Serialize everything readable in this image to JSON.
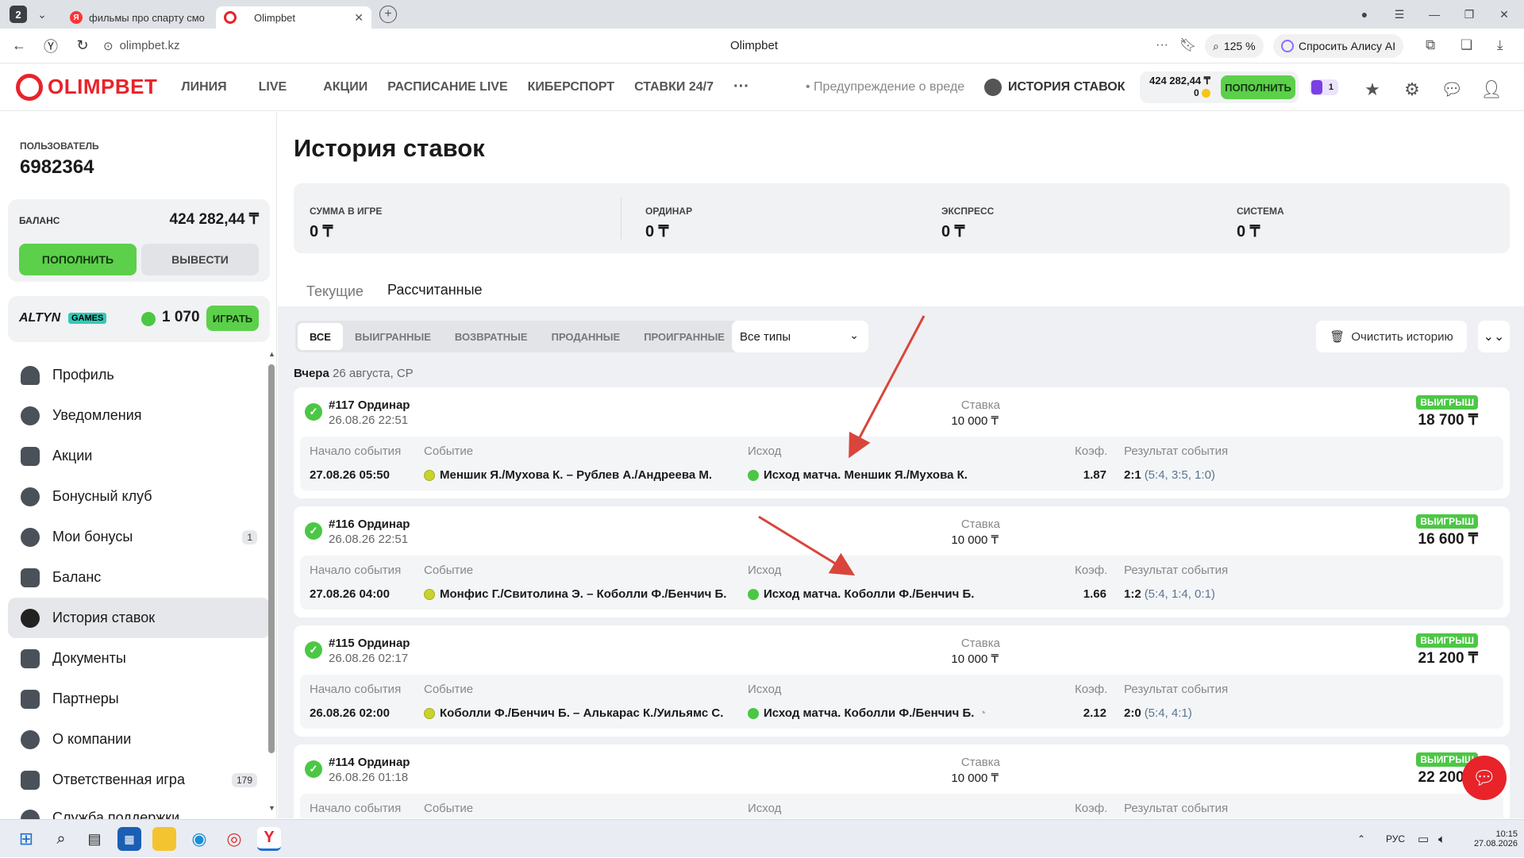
{
  "browser": {
    "tab_count": "2",
    "tabs": [
      {
        "title": "фильмы про спарту смот"
      },
      {
        "title": "Olimpbet"
      }
    ],
    "url": "olimpbet.kz",
    "page_title": "Olimpbet",
    "zoom": "125 %",
    "alice": "Спросить Алису AI"
  },
  "header": {
    "logo": "OLIMPBET",
    "nav": [
      "ЛИНИЯ",
      "LIVE",
      "АКЦИИ",
      "РАСПИСАНИЕ LIVE",
      "КИБЕРСПОРТ",
      "СТАВКИ 24/7"
    ],
    "more": "···",
    "warning": "Предупреждение о вреде",
    "history": "ИСТОРИЯ СТАВОК",
    "balance": "424 282,44 ₸",
    "bonus": "0",
    "topup": "ПОПОЛНИТЬ",
    "promo_count": "1"
  },
  "sidebar": {
    "user_label": "ПОЛЬЗОВАТЕЛЬ",
    "user_id": "6982364",
    "balance_label": "БАЛАНС",
    "balance_value": "424 282,44 ₸",
    "topup": "ПОПОЛНИТЬ",
    "withdraw": "ВЫВЕСТИ",
    "altyn": "ALTYN",
    "games": "GAMES",
    "altyn_value": "1 070",
    "play": "ИГРАТЬ",
    "menu": [
      {
        "label": "Профиль",
        "badge": ""
      },
      {
        "label": "Уведомления",
        "badge": ""
      },
      {
        "label": "Акции",
        "badge": ""
      },
      {
        "label": "Бонусный клуб",
        "badge": ""
      },
      {
        "label": "Мои бонусы",
        "badge": "1"
      },
      {
        "label": "Баланс",
        "badge": ""
      },
      {
        "label": "История ставок",
        "badge": ""
      },
      {
        "label": "Документы",
        "badge": ""
      },
      {
        "label": "Партнеры",
        "badge": ""
      },
      {
        "label": "О компании",
        "badge": ""
      },
      {
        "label": "Ответственная игра",
        "badge": "179"
      },
      {
        "label": "Служба поддержки",
        "badge": ""
      }
    ]
  },
  "main": {
    "title": "История ставок",
    "summary": [
      {
        "label": "СУММА В ИГРЕ",
        "value": "0 ₸"
      },
      {
        "label": "ОРДИНАР",
        "value": "0 ₸"
      },
      {
        "label": "ЭКСПРЕСС",
        "value": "0 ₸"
      },
      {
        "label": "СИСТЕМА",
        "value": "0 ₸"
      }
    ],
    "tabs": [
      "Текущие",
      "Рассчитанные"
    ],
    "filters": [
      "ВСЕ",
      "ВЫИГРАННЫЕ",
      "ВОЗВРАТНЫЕ",
      "ПРОДАННЫЕ",
      "ПРОИГРАННЫЕ"
    ],
    "type_select": "Все типы",
    "clear": "Очистить историю",
    "date_day": "Вчера",
    "date_full": "26 августа, СР",
    "col_labels": {
      "start": "Начало события",
      "event": "Событие",
      "outcome": "Исход",
      "coef": "Коэф.",
      "result": "Результат события",
      "stake": "Ставка",
      "win": "ВЫИГРЫШ"
    },
    "bets": [
      {
        "name": "#117 Ординар",
        "date": "26.08.26 22:51",
        "stake": "10 000 ₸",
        "win": "18 700 ₸",
        "start": "27.08.26 05:50",
        "event": "Меншик Я./Мухова К. – Рублев А./Андреева М.",
        "outcome": "Исход матча. Меншик Я./Мухова К.",
        "coef": "1.87",
        "result": "2:1",
        "result_detail": "(5:4, 3:5, 1:0)"
      },
      {
        "name": "#116 Ординар",
        "date": "26.08.26 22:51",
        "stake": "10 000 ₸",
        "win": "16 600 ₸",
        "start": "27.08.26 04:00",
        "event": "Монфис Г./Свитолина Э. – Коболли Ф./Бенчич Б.",
        "outcome": "Исход матча. Коболли Ф./Бенчич Б.",
        "coef": "1.66",
        "result": "1:2",
        "result_detail": "(5:4, 1:4, 0:1)"
      },
      {
        "name": "#115 Ординар",
        "date": "26.08.26 02:17",
        "stake": "10 000 ₸",
        "win": "21 200 ₸",
        "start": "26.08.26 02:00",
        "event": "Коболли Ф./Бенчич Б. – Алькарас К./Уильямс С.",
        "outcome": "Исход матча. Коболли Ф./Бенчич Б.",
        "coef": "2.12",
        "result": "2:0",
        "result_detail": "(5:4, 4:1)"
      },
      {
        "name": "#114 Ординар",
        "date": "26.08.26 01:18",
        "stake": "10 000 ₸",
        "win": "22 200 ₸",
        "start": "",
        "event": "",
        "outcome": "",
        "coef": "",
        "result": "",
        "result_detail": ""
      }
    ]
  },
  "taskbar": {
    "lang": "РУС",
    "time": "10:15",
    "date": "27.08.2026"
  },
  "colors": {
    "brand": "#e8232a",
    "green": "#5cd04a",
    "win_green": "#4cc745",
    "arrow": "#d9453a"
  }
}
